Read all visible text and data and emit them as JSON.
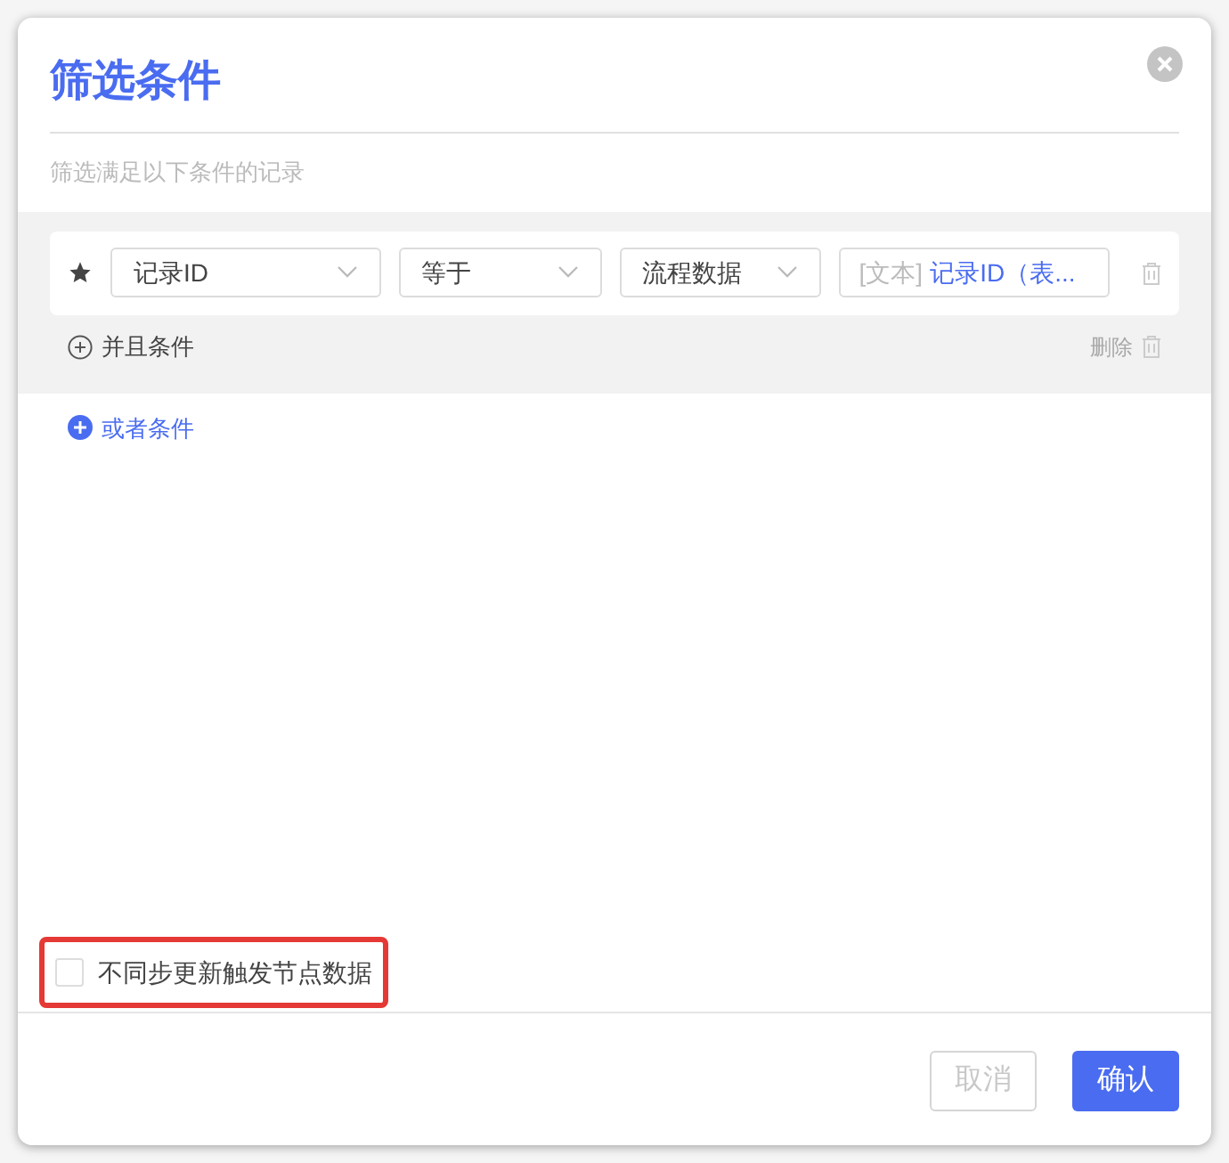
{
  "dialog": {
    "title": "筛选条件",
    "subtitle": "筛选满足以下条件的记录"
  },
  "condition_group": {
    "conditions": [
      {
        "field": "记录ID",
        "operator": "等于",
        "source": "流程数据",
        "value_prefix": "[文本]",
        "value": "记录ID（表..."
      }
    ],
    "add_and": "并且条件",
    "delete": "删除"
  },
  "add_or": "或者条件",
  "option": {
    "label": "不同步更新触发节点数据",
    "checked": false,
    "highlighted": true
  },
  "buttons": [
    {
      "label": "取消",
      "kind": "secondary"
    },
    {
      "label": "确认",
      "kind": "primary"
    }
  ]
}
